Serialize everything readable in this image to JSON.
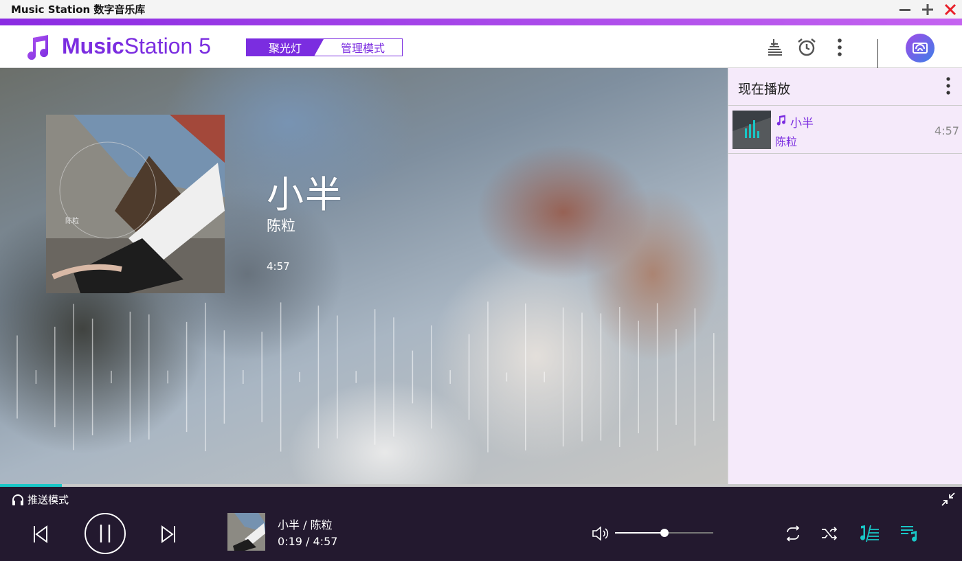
{
  "window": {
    "title": "Music Station 数字音乐库"
  },
  "header": {
    "logo_bold": "Music",
    "logo_rest": "Station 5",
    "mode_spotlight": "聚光灯",
    "mode_manage": "管理模式"
  },
  "stage": {
    "title": "小半",
    "artist": "陈粒",
    "duration": "4:57"
  },
  "now_playing": {
    "title": "现在播放",
    "items": [
      {
        "name": "小半",
        "artist": "陈粒",
        "duration": "4:57"
      }
    ]
  },
  "player": {
    "push_mode_label": "推送模式",
    "track_label": "小半 / 陈粒",
    "time_label": "0:19 / 4:57",
    "progress_fraction": 0.064,
    "volume_fraction": 0.5
  },
  "colors": {
    "accent": "#7b2de0",
    "player_bg": "#23192f",
    "progress": "#19c7c7",
    "panel_bg": "#f5eafa"
  }
}
